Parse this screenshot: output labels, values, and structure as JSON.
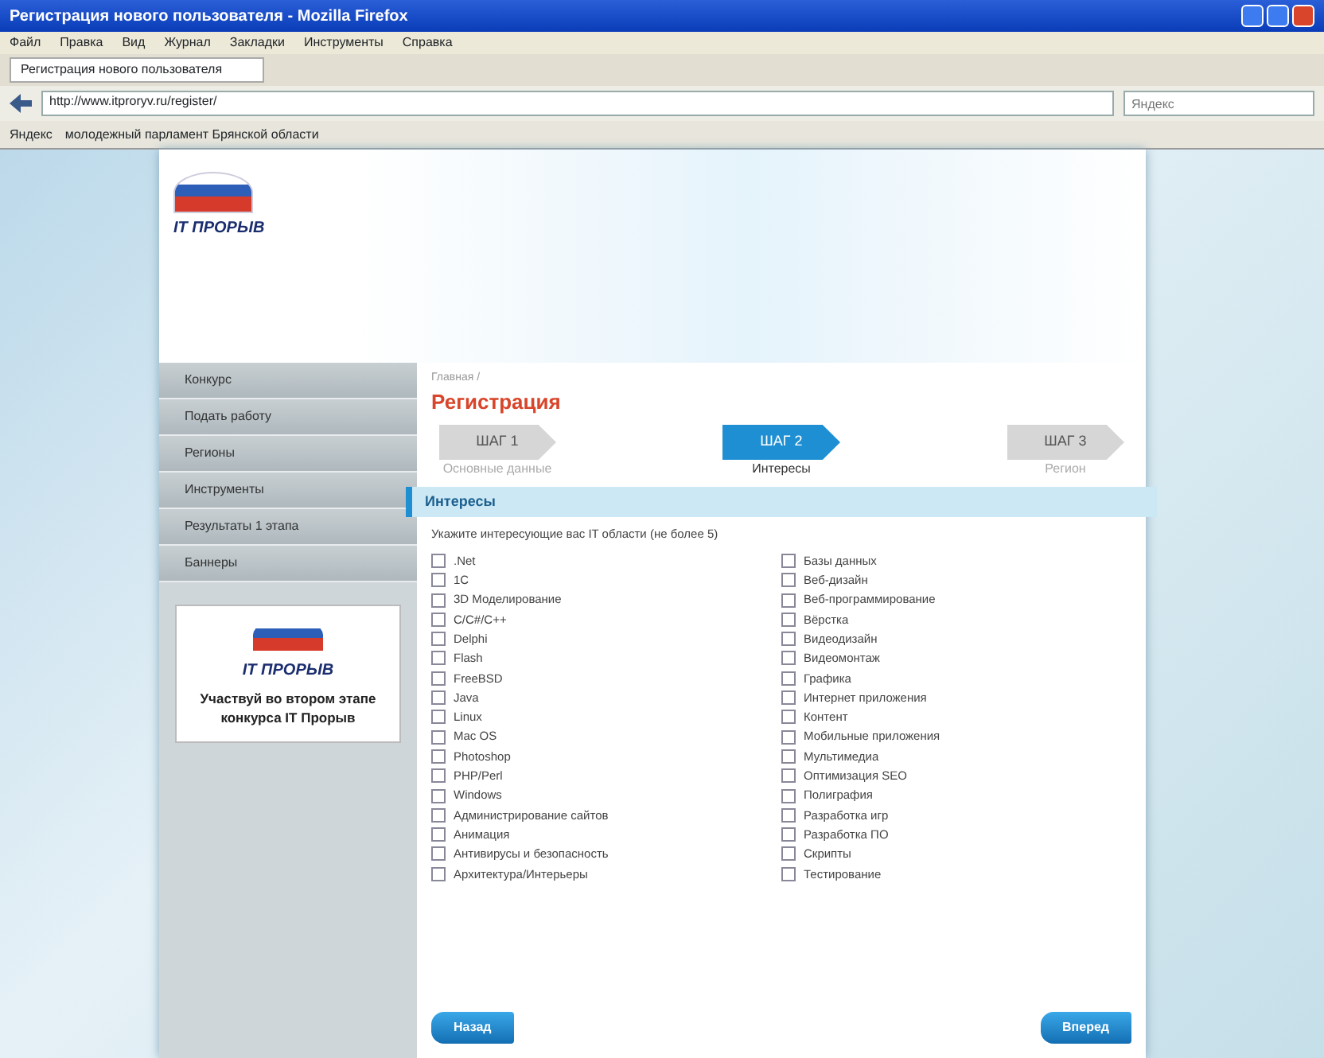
{
  "window": {
    "title": "Регистрация нового пользователя - Mozilla Firefox"
  },
  "menu": [
    "Файл",
    "Правка",
    "Вид",
    "Журнал",
    "Закладки",
    "Инструменты",
    "Справка"
  ],
  "tab": {
    "label": "Регистрация нового пользователя"
  },
  "address": {
    "value": "http://www.itproryv.ru/register/"
  },
  "search": {
    "placeholder": "Яндекс"
  },
  "bookmarks": [
    "Яндекс",
    "молодежный парламент Брянской области"
  ],
  "logo": {
    "text": "IT ПРОРЫВ"
  },
  "sidebar": {
    "items": [
      {
        "label": "Конкурс"
      },
      {
        "label": "Подать работу"
      },
      {
        "label": "Регионы"
      },
      {
        "label": "Инструменты"
      },
      {
        "label": "Результаты 1 этапа"
      },
      {
        "label": "Баннеры"
      }
    ]
  },
  "banner": {
    "logo": "IT ПРОРЫВ",
    "text": "Участвуй во втором этапе конкурса IT Прорыв"
  },
  "breadcrumb": "Главная /",
  "heading": "Регистрация",
  "steps": [
    {
      "label": "ШАГ 1",
      "caption": "Основные данные",
      "selected": false
    },
    {
      "label": "ШАГ 2",
      "caption": "Интересы",
      "selected": true
    },
    {
      "label": "ШАГ 3",
      "caption": "Регион",
      "selected": false
    }
  ],
  "section": {
    "title": "Интересы",
    "prompt": "Укажите интересующие вас IT области (не более 5)"
  },
  "interests": [
    [
      {
        "label": ".Net",
        "checked": false
      },
      {
        "label": "1С",
        "checked": false
      },
      {
        "label": "3D Моделирование",
        "checked": false
      },
      {
        "label": "C/C#/C++",
        "checked": false
      },
      {
        "label": "Delphi",
        "checked": false
      },
      {
        "label": "Flash",
        "checked": false
      },
      {
        "label": "FreeBSD",
        "checked": false
      },
      {
        "label": "Java",
        "checked": false
      },
      {
        "label": "Linux",
        "checked": false
      },
      {
        "label": "Mac OS",
        "checked": false
      },
      {
        "label": "Photoshop",
        "checked": false
      },
      {
        "label": "PHP/Perl",
        "checked": false
      },
      {
        "label": "Windows",
        "checked": false
      },
      {
        "label": "Администрирование сайтов",
        "checked": false
      },
      {
        "label": "Анимация",
        "checked": false
      },
      {
        "label": "Антивирусы и безопасность",
        "checked": false
      },
      {
        "label": "Архитектура/Интерьеры",
        "checked": false
      }
    ],
    [
      {
        "label": "Базы данных",
        "checked": false
      },
      {
        "label": "Веб-дизайн",
        "checked": false
      },
      {
        "label": "Веб-программирование",
        "checked": false
      },
      {
        "label": "Вёрстка",
        "checked": false
      },
      {
        "label": "Видеодизайн",
        "checked": false
      },
      {
        "label": "Видеомонтаж",
        "checked": false
      },
      {
        "label": "Графика",
        "checked": false
      },
      {
        "label": "Интернет приложения",
        "checked": false
      },
      {
        "label": "Контент",
        "checked": false
      },
      {
        "label": "Мобильные приложения",
        "checked": false
      },
      {
        "label": "Мультимедиа",
        "checked": false
      },
      {
        "label": "Оптимизация SEO",
        "checked": false
      },
      {
        "label": "Полиграфия",
        "checked": false
      },
      {
        "label": "Разработка игр",
        "checked": false
      },
      {
        "label": "Разработка ПО",
        "checked": false
      },
      {
        "label": "Скрипты",
        "checked": false
      },
      {
        "label": "Тестирование",
        "checked": false
      }
    ]
  ],
  "buttons": {
    "back": "Назад",
    "next": "Вперед"
  }
}
